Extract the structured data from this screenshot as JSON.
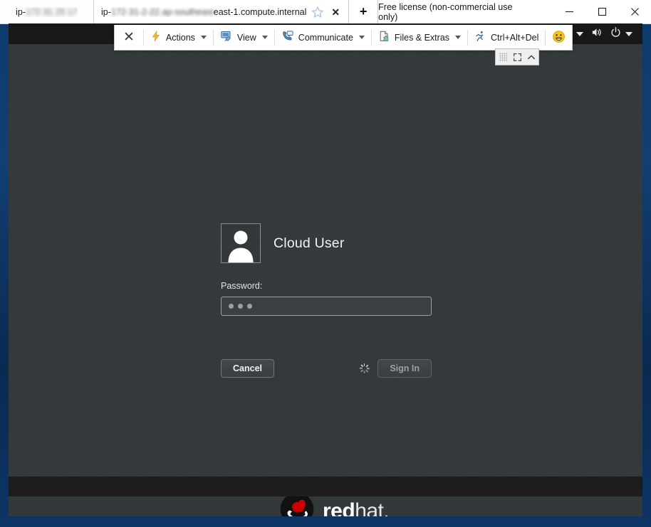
{
  "window": {
    "license_text": "Free license (non-commercial use only)",
    "controls": {
      "minimize": "minimize-icon",
      "maximize": "maximize-icon",
      "close": "close-icon"
    },
    "tabs": [
      {
        "label": "ip-",
        "redacted_suffix": "172 31 25 17",
        "active": false
      },
      {
        "label": "ip-",
        "redacted_mid": "172-31-2-22.ap-southeast",
        "label_tail": "east-1.compute.internal",
        "active": true,
        "star_icon": "star-icon",
        "close_icon": "close-tab-icon"
      }
    ],
    "new_tab_label": "+"
  },
  "toolbar": {
    "close_label": "✕",
    "items": [
      {
        "label": "Actions",
        "icon": "lightning-bolt-icon",
        "has_caret": true
      },
      {
        "label": "View",
        "icon": "monitor-brush-icon",
        "has_caret": true
      },
      {
        "label": "Communicate",
        "icon": "phone-chat-icon",
        "has_caret": true
      },
      {
        "label": "Files & Extras",
        "icon": "file-puzzle-icon",
        "has_caret": true
      },
      {
        "label": "Ctrl+Alt+Del",
        "icon": "running-man-icon",
        "has_caret": false
      },
      {
        "label": "",
        "icon": "smiley-face-icon",
        "has_caret": false
      }
    ],
    "float_widget": {
      "grip_icon": "drag-grip-icon",
      "fullscreen_icon": "fullscreen-icon",
      "collapse_icon": "chevron-up-icon"
    }
  },
  "gnome": {
    "tray": [
      {
        "icon": "accessibility-icon",
        "has_caret": true
      },
      {
        "icon": "volume-icon",
        "has_caret": false
      },
      {
        "icon": "power-icon",
        "has_caret": true
      }
    ]
  },
  "login": {
    "avatar_icon": "user-avatar-icon",
    "username": "Cloud User",
    "password_label": "Password:",
    "password_value": "•••",
    "password_dots": 3,
    "cancel_label": "Cancel",
    "signin_label": "Sign In",
    "spinner_icon": "loading-spinner-icon",
    "spinner_visible": true
  },
  "branding": {
    "logo_icon": "redhat-shadowman-icon",
    "word_bold": "red",
    "word_thin": "hat",
    "word_dot": "."
  },
  "colors": {
    "window_border": "#0d3a6b",
    "titlebar_bg": "#ffffff",
    "desktop_bg": "#34393b",
    "gnome_bar": "#181818",
    "redhat_red": "#cc0000",
    "accent_text": "#f2f2f2"
  }
}
